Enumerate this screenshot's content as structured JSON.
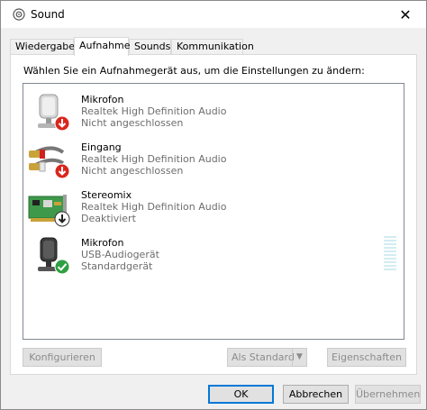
{
  "window": {
    "title": "Sound",
    "close_glyph": "✕"
  },
  "tabs": [
    {
      "label": "Wiedergabe",
      "active": false
    },
    {
      "label": "Aufnahme",
      "active": true
    },
    {
      "label": "Sounds",
      "active": false
    },
    {
      "label": "Kommunikation",
      "active": false
    }
  ],
  "panel": {
    "instruction": "Wählen Sie ein Aufnahmegerät aus, um die Einstellungen zu ändern:"
  },
  "devices": [
    {
      "name": "Mikrofon",
      "driver": "Realtek High Definition Audio",
      "status": "Nicht angeschlossen",
      "icon": "microphone-icon",
      "badge": "disconnected-icon"
    },
    {
      "name": "Eingang",
      "driver": "Realtek High Definition Audio",
      "status": "Nicht angeschlossen",
      "icon": "rca-cable-icon",
      "badge": "disconnected-icon"
    },
    {
      "name": "Stereomix",
      "driver": "Realtek High Definition Audio",
      "status": "Deaktiviert",
      "icon": "sound-card-icon",
      "badge": "disabled-icon"
    },
    {
      "name": "Mikrofon",
      "driver": "USB-Audiogerät",
      "status": "Standardgerät",
      "icon": "usb-microphone-icon",
      "badge": "default-check-icon",
      "level": 0
    }
  ],
  "panel_buttons": {
    "configure": "Konfigurieren",
    "set_default": "Als Standard",
    "properties": "Eigenschaften"
  },
  "dialog_buttons": {
    "ok": "OK",
    "cancel": "Abbrechen",
    "apply": "Übernehmen"
  },
  "colors": {
    "accent": "#0078d7",
    "disconnected": "#d9261c",
    "default_ok": "#2ea043",
    "meter": "#d3ecf3"
  }
}
